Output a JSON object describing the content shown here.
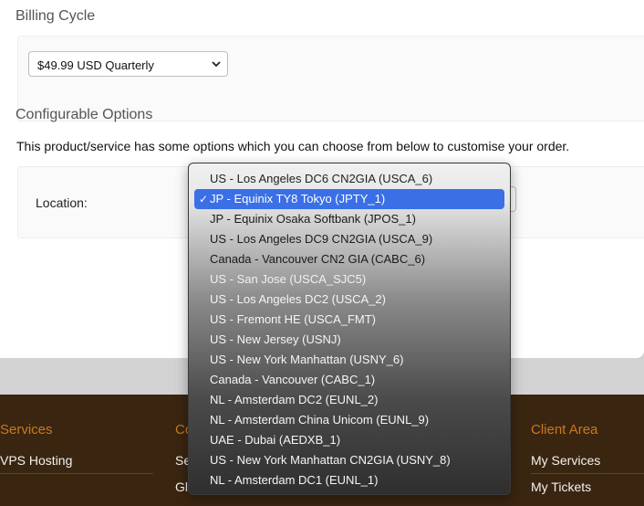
{
  "billing": {
    "title": "Billing Cycle",
    "selected": "$49.99 USD Quarterly"
  },
  "configurable": {
    "title": "Configurable Options",
    "description": "This product/service has some options which you can choose from below to customise your order.",
    "location_label": "Location:"
  },
  "dropdown": {
    "options": [
      {
        "label": "US - Los Angeles DC6 CN2GIA (USCA_6)",
        "selected": false
      },
      {
        "label": "JP - Equinix TY8 Tokyo (JPTY_1)",
        "selected": true
      },
      {
        "label": "JP - Equinix Osaka Softbank (JPOS_1)",
        "selected": false
      },
      {
        "label": "US - Los Angeles DC9 CN2GIA (USCA_9)",
        "selected": false
      },
      {
        "label": "Canada - Vancouver CN2 GIA (CABC_6)",
        "selected": false
      },
      {
        "label": "US - San Jose (USCA_SJC5)",
        "selected": false
      },
      {
        "label": "US - Los Angeles DC2 (USCA_2)",
        "selected": false
      },
      {
        "label": "US - Fremont HE (USCA_FMT)",
        "selected": false
      },
      {
        "label": "US - New Jersey (USNJ)",
        "selected": false
      },
      {
        "label": "US - New York Manhattan (USNY_6)",
        "selected": false
      },
      {
        "label": "Canada - Vancouver (CABC_1)",
        "selected": false
      },
      {
        "label": "NL - Amsterdam DC2 (EUNL_2)",
        "selected": false
      },
      {
        "label": "NL - Amsterdam China Unicom (EUNL_9)",
        "selected": false
      },
      {
        "label": "UAE - Dubai (AEDXB_1)",
        "selected": false
      },
      {
        "label": "US - New York Manhattan CN2GIA (USNY_8)",
        "selected": false
      },
      {
        "label": "NL - Amsterdam DC1 (EUNL_1)",
        "selected": false
      }
    ],
    "check_glyph": "✓"
  },
  "footer": {
    "col1_heading": "Services",
    "col1_link1": "VPS Hosting",
    "col2_heading": "Co",
    "col2_link1": "Se",
    "col2_link2": "Gl",
    "col3_heading": "Client Area",
    "col3_link1": "My Services",
    "col3_link2": "My Tickets"
  },
  "colors": {
    "footer_bg": "#3a2510",
    "footer_heading": "#c87a1e",
    "selected_option": "#3a6fe6"
  }
}
